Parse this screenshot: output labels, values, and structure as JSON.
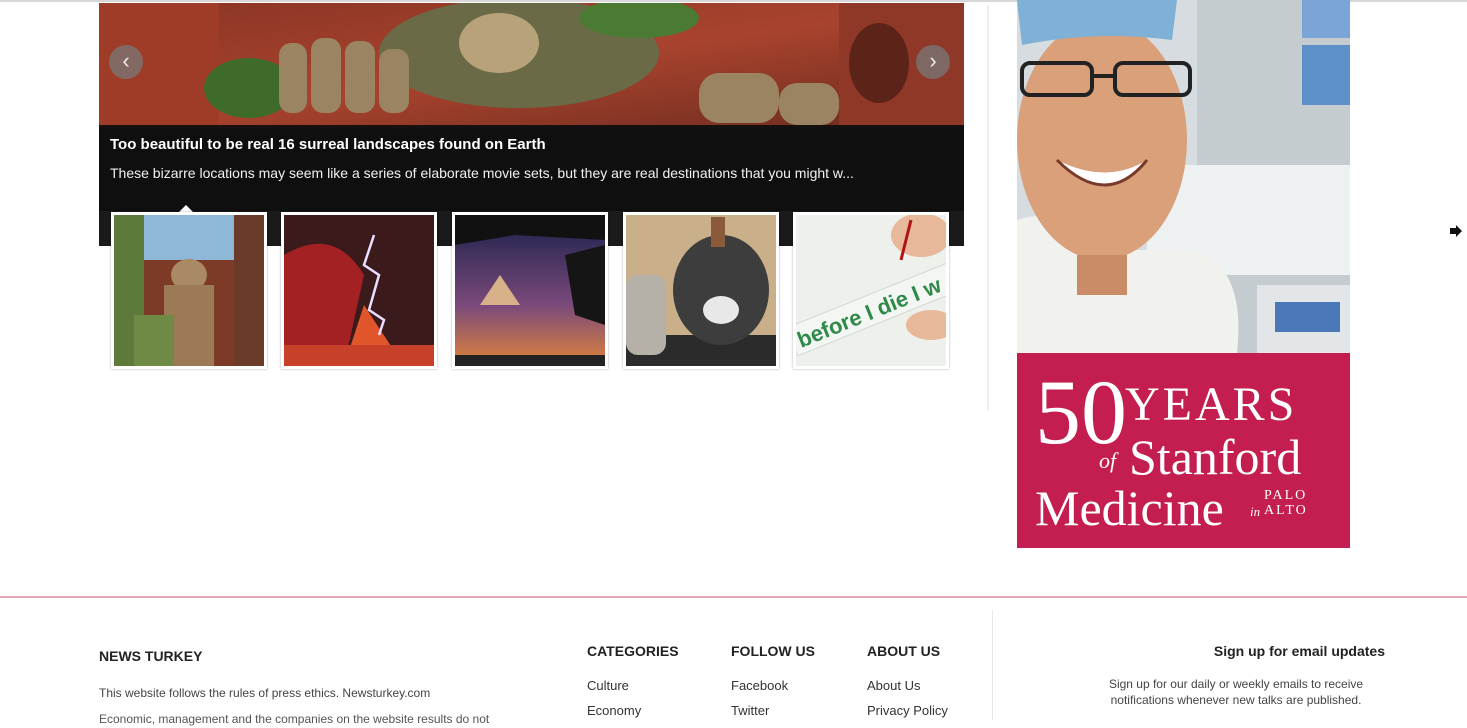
{
  "slider": {
    "title": "Too beautiful to be real 16 surreal landscapes found on Earth",
    "description": "These bizarre locations may seem like a series of elaborate movie sets, but they are real destinations that you might w...",
    "prev_icon": "chevron-left-icon",
    "next_icon": "chevron-right-icon",
    "prev_glyph": "‹",
    "next_glyph": "›",
    "thumbnails": [
      {
        "name": "thumb-buddha",
        "caption": ""
      },
      {
        "name": "thumb-volcano-lightning",
        "caption": ""
      },
      {
        "name": "thumb-sunset-hammock",
        "caption": ""
      },
      {
        "name": "thumb-screaming-face",
        "caption": ""
      },
      {
        "name": "thumb-before-i-die",
        "caption": "before I die I w"
      }
    ]
  },
  "ad": {
    "line1_number": "5",
    "line1_zero": "0",
    "line1_word": "YEARS",
    "of": "of",
    "stanford": "Stanford",
    "medicine": "Medicine",
    "in": "in",
    "palo": "PALO",
    "alto": "ALTO",
    "background_color": "#c41d50"
  },
  "footer": {
    "brand": "NEWS TURKEY",
    "text1": "This website follows the rules of press ethics. Newsturkey.com",
    "text2": "Economic, management and the companies on the website results do not",
    "columns": [
      {
        "heading": "CATEGORIES",
        "links": [
          "Culture",
          "Economy"
        ]
      },
      {
        "heading": "FOLLOW US",
        "links": [
          "Facebook",
          "Twitter"
        ]
      },
      {
        "heading": "ABOUT US",
        "links": [
          "About Us",
          "Privacy Policy"
        ]
      }
    ],
    "signup_title": "Sign up for email updates",
    "signup_text": "Sign up for our daily or weekly emails to receive notifications whenever new talks are published."
  },
  "colors": {
    "accent_line": "#e6a7b4",
    "caption_bg": "#0f0f0f"
  }
}
